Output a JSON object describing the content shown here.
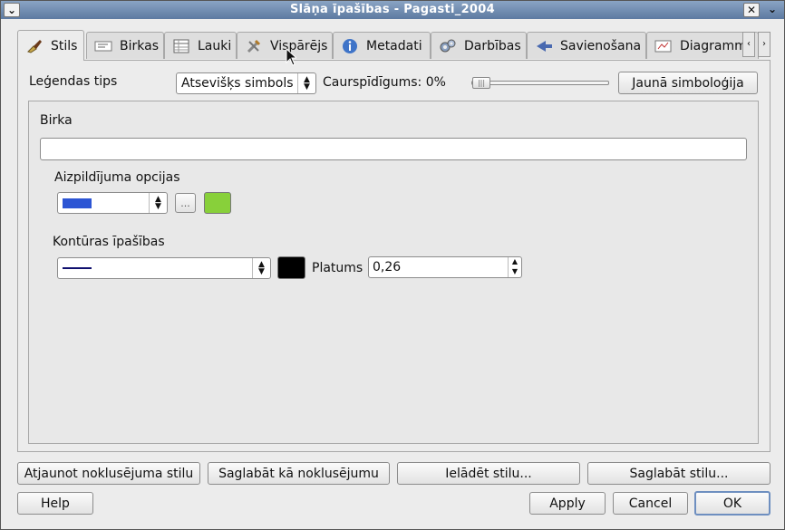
{
  "window": {
    "title": "Slāņa īpašības - Pagasti_2004"
  },
  "tabs": [
    {
      "label": "Stils",
      "icon": "brush-icon"
    },
    {
      "label": "Birkas",
      "icon": "label-icon"
    },
    {
      "label": "Lauki",
      "icon": "table-icon"
    },
    {
      "label": "Vispārējs",
      "icon": "tools-icon"
    },
    {
      "label": "Metadati",
      "icon": "info-icon"
    },
    {
      "label": "Darbības",
      "icon": "gears-icon"
    },
    {
      "label": "Savienošana",
      "icon": "join-icon"
    },
    {
      "label": "Diagramm",
      "icon": "diagram-icon"
    }
  ],
  "style": {
    "legend_type_label": "Leģendas tips",
    "legend_type_value": "Atsevišķs simbols",
    "transparency_label": "Caurspīdīgums: 0%",
    "transparency_percent": 0,
    "new_symbology_label": "Jaunā simboloģija",
    "tag_label": "Birka",
    "tag_value": "",
    "fill_options_label": "Aizpildījuma opcijas",
    "fill_pattern_color": "#2c55d4",
    "fill_more_label": "...",
    "fill_color": "#88d03a",
    "outline_label": "Kontūras īpašības",
    "outline_line_color": "#10106e",
    "outline_color": "#000000",
    "width_label": "Platums",
    "width_value": "0,26"
  },
  "buttons": {
    "restore_default": "Atjaunot noklusējuma stilu",
    "save_default": "Saglabāt kā noklusējumu",
    "load_style": "Ielādēt stilu...",
    "save_style": "Saglabāt stilu...",
    "help": "Help",
    "apply": "Apply",
    "cancel": "Cancel",
    "ok": "OK"
  }
}
